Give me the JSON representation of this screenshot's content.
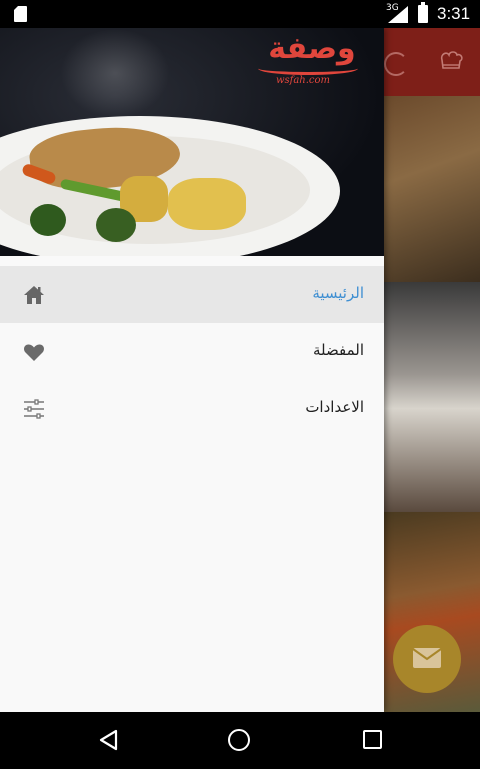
{
  "status_bar": {
    "time": "3:31",
    "network": "3G",
    "icons": [
      "sd-card-icon",
      "signal-icon",
      "battery-icon"
    ]
  },
  "drawer": {
    "logo": {
      "arabic": "وصفة",
      "latin": "wsfah.com",
      "color": "#e0463c"
    },
    "menu": [
      {
        "label": "الرئيسية",
        "icon": "home-icon",
        "active": true
      },
      {
        "label": "المفضلة",
        "icon": "heart-icon",
        "active": false
      },
      {
        "label": "الاعدادات",
        "icon": "sliders-icon",
        "active": false
      }
    ]
  },
  "colors": {
    "toolbar": "#7e1f18",
    "active_text": "#3f8fd2",
    "fab": "#e8b83a",
    "drawer_bg": "#f9f9f9"
  },
  "nav_bar": {
    "icons": [
      "back-icon",
      "home-circle-icon",
      "recents-icon"
    ]
  }
}
